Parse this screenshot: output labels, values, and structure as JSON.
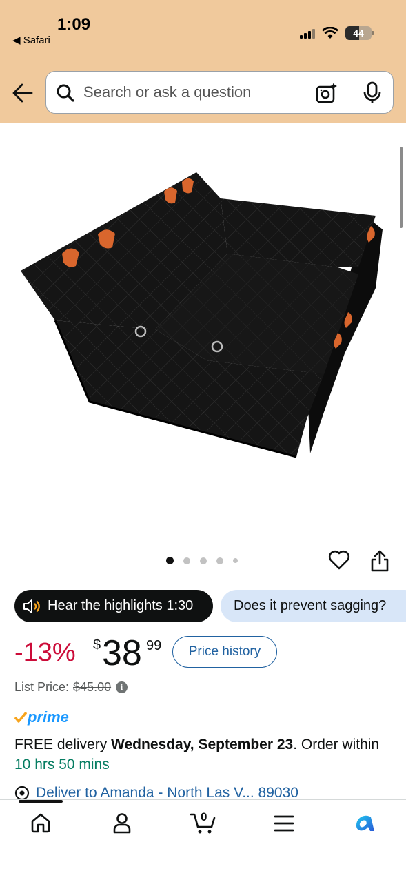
{
  "status_bar": {
    "time": "1:09",
    "back_app": "◀ Safari",
    "battery": "44"
  },
  "search": {
    "placeholder": "Search or ask a question"
  },
  "gallery": {
    "image_count": 5,
    "active_index": 0
  },
  "chips": {
    "hear_label": "Hear the highlights 1:30",
    "question_label": "Does it prevent sagging?"
  },
  "price": {
    "discount": "-13%",
    "currency": "$",
    "whole": "38",
    "fraction": "99",
    "history_button": "Price history",
    "list_price_label": "List Price:",
    "list_price_value": "$45.00"
  },
  "prime": {
    "label": "prime"
  },
  "delivery": {
    "prefix": "FREE delivery ",
    "date": "Wednesday, September 23",
    "middle": ". Order within ",
    "countdown": "10 hrs 50 mins"
  },
  "deliver_to": {
    "text": "Deliver to Amanda - North Las V... 89030"
  },
  "colors": {
    "header_bg": "#f0c99c",
    "discount_red": "#cc0c39",
    "link_blue": "#2162a1",
    "prime_blue": "#1a98ff",
    "countdown_green": "#067d62"
  },
  "bottom_nav": {
    "cart_count": "0"
  }
}
